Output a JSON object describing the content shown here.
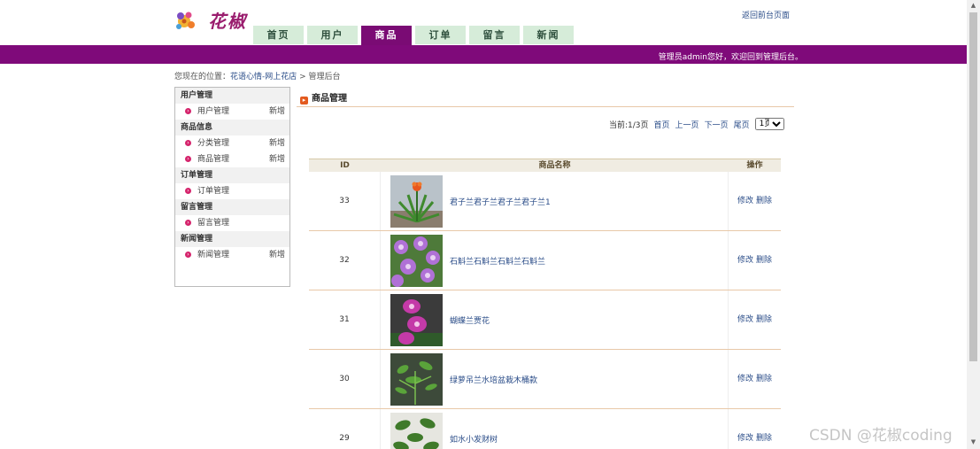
{
  "header": {
    "logo_text": "花椒",
    "front_link": "返回前台页面",
    "welcome": "管理员admin您好，欢迎回到管理后台。"
  },
  "nav": [
    {
      "label": "首页",
      "active": false
    },
    {
      "label": "用户",
      "active": false
    },
    {
      "label": "商品",
      "active": true
    },
    {
      "label": "订单",
      "active": false
    },
    {
      "label": "留言",
      "active": false
    },
    {
      "label": "新闻",
      "active": false
    }
  ],
  "breadcrumb": {
    "prefix": "您现在的位置：",
    "link": "花语心情-网上花店",
    "sep": " > ",
    "current": "管理后台"
  },
  "sidebar": {
    "groups": [
      {
        "title": "用户管理",
        "items": [
          {
            "label": "用户管理",
            "add": "新增"
          }
        ]
      },
      {
        "title": "商品信息",
        "items": [
          {
            "label": "分类管理",
            "add": "新增"
          },
          {
            "label": "商品管理",
            "add": "新增"
          }
        ]
      },
      {
        "title": "订单管理",
        "items": [
          {
            "label": "订单管理",
            "add": ""
          }
        ]
      },
      {
        "title": "留言管理",
        "items": [
          {
            "label": "留言管理",
            "add": ""
          }
        ]
      },
      {
        "title": "新闻管理",
        "items": [
          {
            "label": "新闻管理",
            "add": "新增"
          }
        ]
      }
    ]
  },
  "content": {
    "title": "商品管理",
    "pager": {
      "current": "当前:1/3页",
      "first": "首页",
      "prev": "上一页",
      "next": "下一页",
      "last": "尾页",
      "select_value": "1页"
    },
    "table": {
      "headers": {
        "id": "ID",
        "name": "商品名称",
        "op": "操作"
      },
      "rows": [
        {
          "id": "33",
          "name": "君子兰君子兰君子兰君子兰1",
          "edit": "修改",
          "delete": "删除",
          "img": "clivia"
        },
        {
          "id": "32",
          "name": "石斛兰石斛兰石斛兰石斛兰",
          "edit": "修改",
          "delete": "删除",
          "img": "dendrobium"
        },
        {
          "id": "31",
          "name": "蝴蝶兰贾花",
          "edit": "修改",
          "delete": "删除",
          "img": "phalaenopsis"
        },
        {
          "id": "30",
          "name": "绿萝吊兰水培盆栽木桶款",
          "edit": "修改",
          "delete": "删除",
          "img": "pothos"
        },
        {
          "id": "29",
          "name": "如水小发财树",
          "edit": "修改",
          "delete": "删除",
          "img": "money-tree"
        }
      ]
    }
  },
  "watermark": "CSDN @花椒coding",
  "colors": {
    "brand_purple": "#7f0a7a",
    "nav_tab": "#d6ecd9",
    "link": "#2a4c88"
  }
}
